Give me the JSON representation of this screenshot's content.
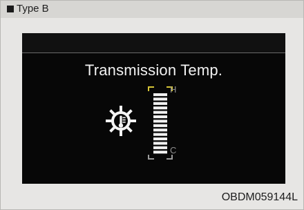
{
  "header": {
    "type_label": "Type B"
  },
  "display": {
    "title": "Transmission Temp.",
    "gauge": {
      "high_label": "H",
      "low_label": "C",
      "segment_count": 14,
      "marker_colors": {
        "high": "#d7c637",
        "low": "#9b9b9b"
      }
    }
  },
  "footer": {
    "code": "OBDM059144L"
  }
}
